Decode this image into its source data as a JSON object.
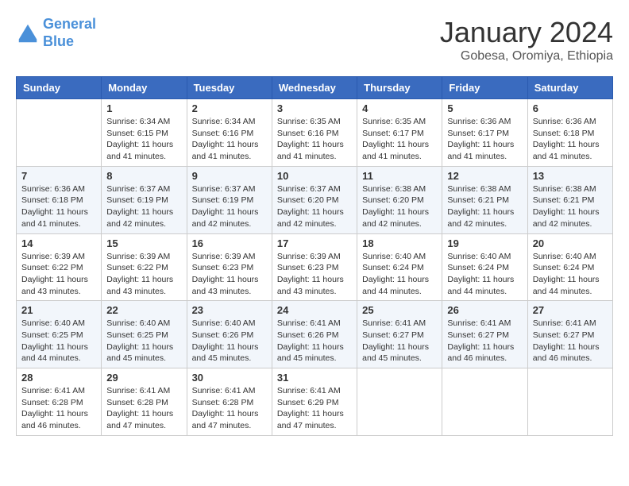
{
  "logo": {
    "line1": "General",
    "line2": "Blue",
    "icon": "▶"
  },
  "title": "January 2024",
  "subtitle": "Gobesa, Oromiya, Ethiopia",
  "weekdays": [
    "Sunday",
    "Monday",
    "Tuesday",
    "Wednesday",
    "Thursday",
    "Friday",
    "Saturday"
  ],
  "weeks": [
    [
      {
        "day": "",
        "info": ""
      },
      {
        "day": "1",
        "info": "Sunrise: 6:34 AM\nSunset: 6:15 PM\nDaylight: 11 hours and 41 minutes."
      },
      {
        "day": "2",
        "info": "Sunrise: 6:34 AM\nSunset: 6:16 PM\nDaylight: 11 hours and 41 minutes."
      },
      {
        "day": "3",
        "info": "Sunrise: 6:35 AM\nSunset: 6:16 PM\nDaylight: 11 hours and 41 minutes."
      },
      {
        "day": "4",
        "info": "Sunrise: 6:35 AM\nSunset: 6:17 PM\nDaylight: 11 hours and 41 minutes."
      },
      {
        "day": "5",
        "info": "Sunrise: 6:36 AM\nSunset: 6:17 PM\nDaylight: 11 hours and 41 minutes."
      },
      {
        "day": "6",
        "info": "Sunrise: 6:36 AM\nSunset: 6:18 PM\nDaylight: 11 hours and 41 minutes."
      }
    ],
    [
      {
        "day": "7",
        "info": "Sunrise: 6:36 AM\nSunset: 6:18 PM\nDaylight: 11 hours and 41 minutes."
      },
      {
        "day": "8",
        "info": "Sunrise: 6:37 AM\nSunset: 6:19 PM\nDaylight: 11 hours and 42 minutes."
      },
      {
        "day": "9",
        "info": "Sunrise: 6:37 AM\nSunset: 6:19 PM\nDaylight: 11 hours and 42 minutes."
      },
      {
        "day": "10",
        "info": "Sunrise: 6:37 AM\nSunset: 6:20 PM\nDaylight: 11 hours and 42 minutes."
      },
      {
        "day": "11",
        "info": "Sunrise: 6:38 AM\nSunset: 6:20 PM\nDaylight: 11 hours and 42 minutes."
      },
      {
        "day": "12",
        "info": "Sunrise: 6:38 AM\nSunset: 6:21 PM\nDaylight: 11 hours and 42 minutes."
      },
      {
        "day": "13",
        "info": "Sunrise: 6:38 AM\nSunset: 6:21 PM\nDaylight: 11 hours and 42 minutes."
      }
    ],
    [
      {
        "day": "14",
        "info": "Sunrise: 6:39 AM\nSunset: 6:22 PM\nDaylight: 11 hours and 43 minutes."
      },
      {
        "day": "15",
        "info": "Sunrise: 6:39 AM\nSunset: 6:22 PM\nDaylight: 11 hours and 43 minutes."
      },
      {
        "day": "16",
        "info": "Sunrise: 6:39 AM\nSunset: 6:23 PM\nDaylight: 11 hours and 43 minutes."
      },
      {
        "day": "17",
        "info": "Sunrise: 6:39 AM\nSunset: 6:23 PM\nDaylight: 11 hours and 43 minutes."
      },
      {
        "day": "18",
        "info": "Sunrise: 6:40 AM\nSunset: 6:24 PM\nDaylight: 11 hours and 44 minutes."
      },
      {
        "day": "19",
        "info": "Sunrise: 6:40 AM\nSunset: 6:24 PM\nDaylight: 11 hours and 44 minutes."
      },
      {
        "day": "20",
        "info": "Sunrise: 6:40 AM\nSunset: 6:24 PM\nDaylight: 11 hours and 44 minutes."
      }
    ],
    [
      {
        "day": "21",
        "info": "Sunrise: 6:40 AM\nSunset: 6:25 PM\nDaylight: 11 hours and 44 minutes."
      },
      {
        "day": "22",
        "info": "Sunrise: 6:40 AM\nSunset: 6:25 PM\nDaylight: 11 hours and 45 minutes."
      },
      {
        "day": "23",
        "info": "Sunrise: 6:40 AM\nSunset: 6:26 PM\nDaylight: 11 hours and 45 minutes."
      },
      {
        "day": "24",
        "info": "Sunrise: 6:41 AM\nSunset: 6:26 PM\nDaylight: 11 hours and 45 minutes."
      },
      {
        "day": "25",
        "info": "Sunrise: 6:41 AM\nSunset: 6:27 PM\nDaylight: 11 hours and 45 minutes."
      },
      {
        "day": "26",
        "info": "Sunrise: 6:41 AM\nSunset: 6:27 PM\nDaylight: 11 hours and 46 minutes."
      },
      {
        "day": "27",
        "info": "Sunrise: 6:41 AM\nSunset: 6:27 PM\nDaylight: 11 hours and 46 minutes."
      }
    ],
    [
      {
        "day": "28",
        "info": "Sunrise: 6:41 AM\nSunset: 6:28 PM\nDaylight: 11 hours and 46 minutes."
      },
      {
        "day": "29",
        "info": "Sunrise: 6:41 AM\nSunset: 6:28 PM\nDaylight: 11 hours and 47 minutes."
      },
      {
        "day": "30",
        "info": "Sunrise: 6:41 AM\nSunset: 6:28 PM\nDaylight: 11 hours and 47 minutes."
      },
      {
        "day": "31",
        "info": "Sunrise: 6:41 AM\nSunset: 6:29 PM\nDaylight: 11 hours and 47 minutes."
      },
      {
        "day": "",
        "info": ""
      },
      {
        "day": "",
        "info": ""
      },
      {
        "day": "",
        "info": ""
      }
    ]
  ]
}
